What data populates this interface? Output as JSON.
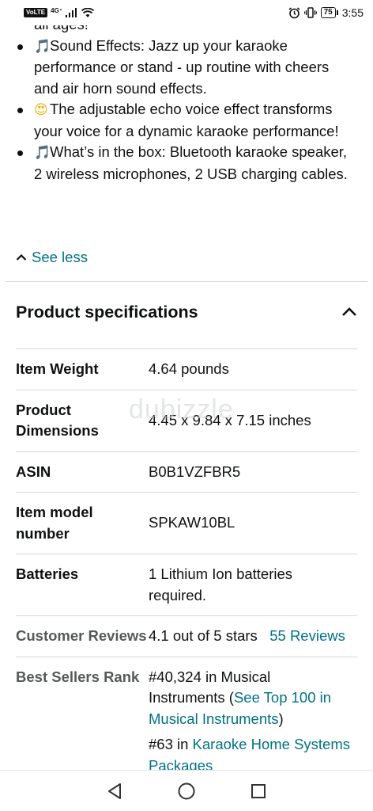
{
  "status_bar": {
    "volte": "VoLTE",
    "network": "4G⁺",
    "battery": "75",
    "time": "3:55"
  },
  "bullets": [
    {
      "icon": "musical-note-emoji",
      "emoji": "🎵",
      "text": "Sound Effects: Jazz up your karaoke performance or stand - up routine with cheers and air horn sound effects."
    },
    {
      "icon": "heart-eyes-emoji",
      "emoji": "😍",
      "text": "The adjustable echo voice effect transforms your voice for a dynamic karaoke performance!"
    },
    {
      "icon": "musical-note-emoji",
      "emoji": "🎵",
      "text": "What’s in the box: Bluetooth karaoke speaker, 2 wireless microphones, 2 USB charging cables."
    }
  ],
  "cut_text": "all ages!",
  "see_less": "See less",
  "specs": {
    "title": "Product specifications",
    "rows": [
      {
        "key": "Item Weight",
        "value": "4.64 pounds"
      },
      {
        "key": "Product Dimensions",
        "value": "4.45 x 9.84 x 7.15 inches"
      },
      {
        "key": "ASIN",
        "value": "B0B1VZFBR5"
      },
      {
        "key": "Item model number",
        "value": "SPKAW10BL"
      },
      {
        "key": "Batteries",
        "value": "1 Lithium Ion batteries required."
      }
    ],
    "reviews": {
      "key": "Customer Reviews",
      "stars": "4.1 out of 5 stars",
      "link": "55 Reviews"
    },
    "rank": {
      "key": "Best Sellers Rank",
      "line1_prefix": "#40,324 in Musical Instruments (",
      "line1_link": "See Top 100 in Musical Instruments",
      "line1_suffix": ")",
      "line2_prefix": "#63 in ",
      "line2_link": "Karaoke Home Systems Packages"
    }
  },
  "watermark": "dubizzle",
  "colors": {
    "link": "#007185",
    "text": "#0f1111",
    "muted": "#565959",
    "divider": "#d5d9d9"
  }
}
